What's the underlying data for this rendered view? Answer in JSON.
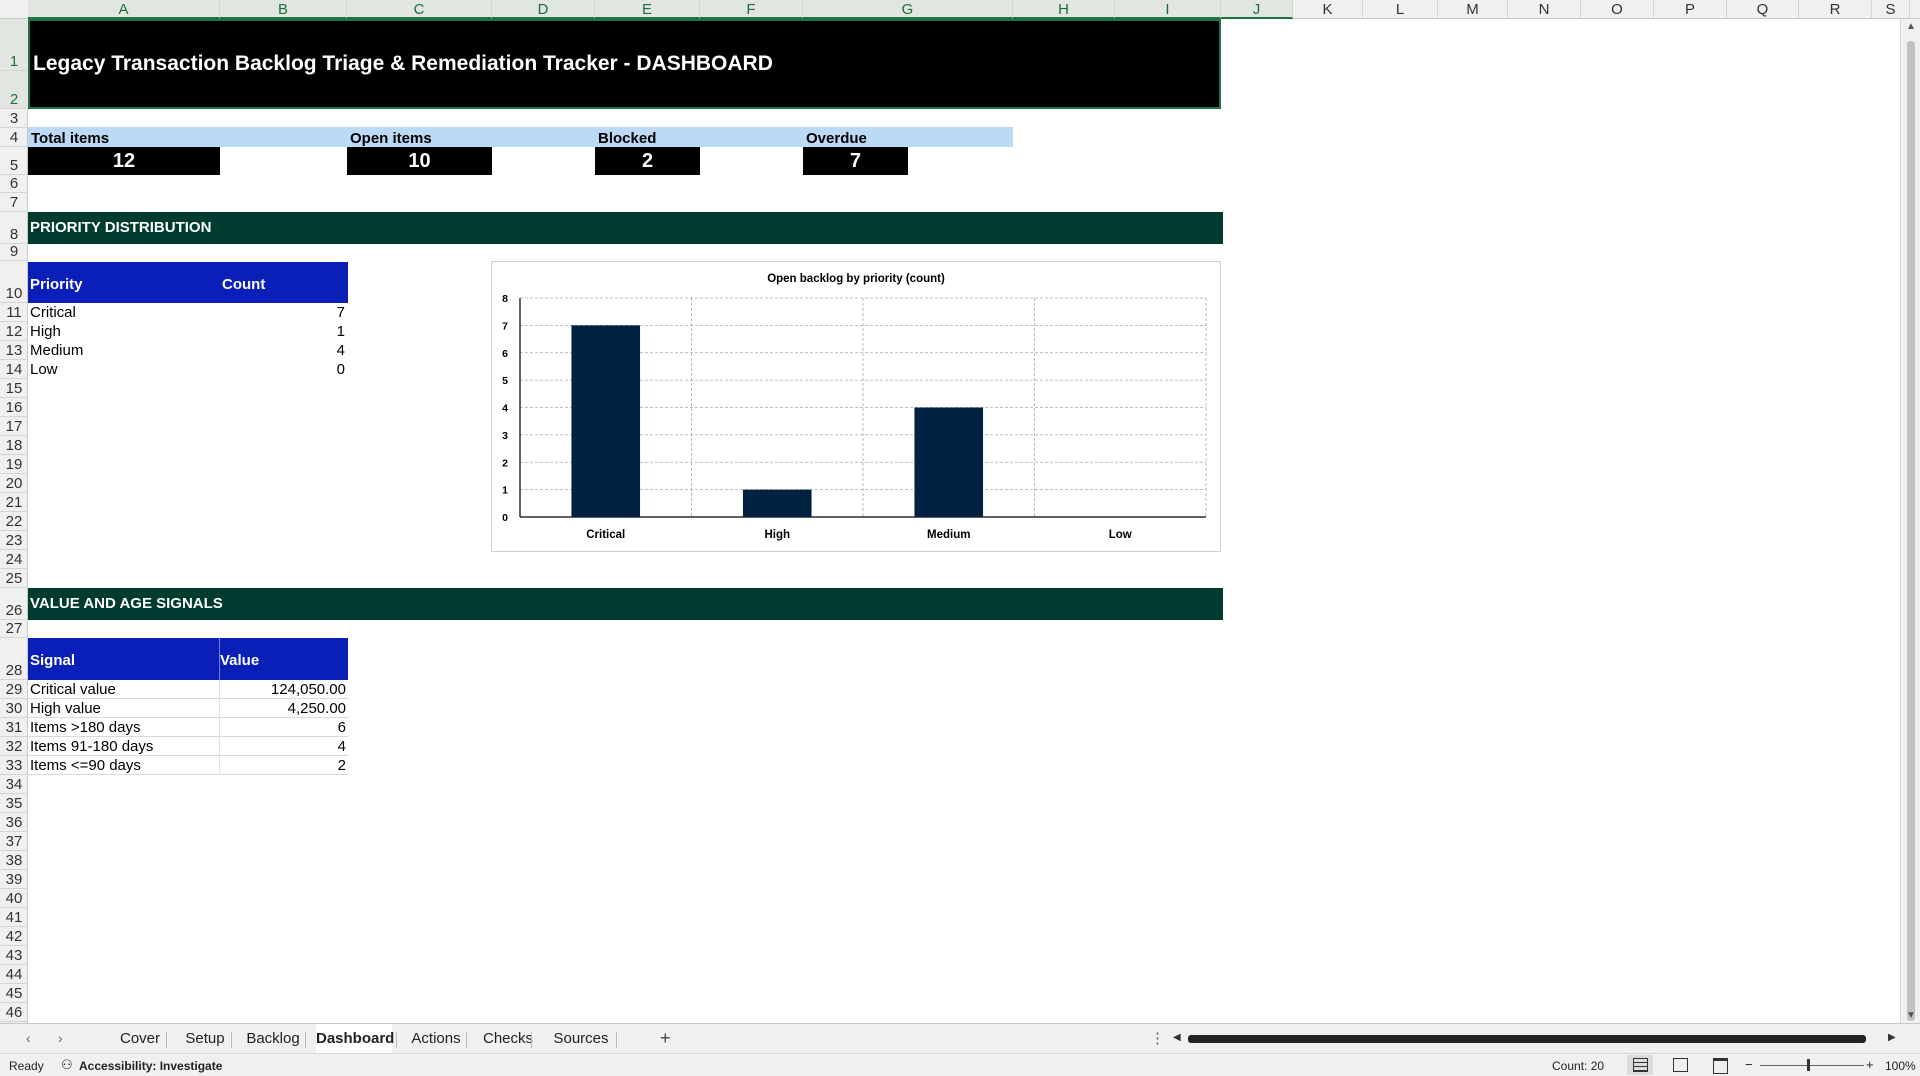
{
  "columns": [
    "A",
    "B",
    "C",
    "D",
    "E",
    "F",
    "G",
    "H",
    "I",
    "J",
    "K",
    "L",
    "M",
    "N",
    "O",
    "P",
    "Q",
    "R",
    "S"
  ],
  "rows": [
    "1",
    "2",
    "3",
    "4",
    "5",
    "6",
    "7",
    "8",
    "9",
    "10",
    "11",
    "12",
    "13",
    "14",
    "15",
    "16",
    "17",
    "18",
    "19",
    "20",
    "21",
    "22",
    "23",
    "24",
    "25",
    "26",
    "27",
    "28",
    "29",
    "30",
    "31",
    "32",
    "33",
    "34",
    "35",
    "36",
    "37",
    "38",
    "39",
    "40",
    "41",
    "42",
    "43",
    "44",
    "45",
    "46"
  ],
  "title": "Legacy Transaction Backlog Triage & Remediation Tracker - DASHBOARD",
  "kpis": {
    "total_label": "Total items",
    "total_value": "12",
    "open_label": "Open items",
    "open_value": "10",
    "blocked_label": "Blocked",
    "blocked_value": "2",
    "overdue_label": "Overdue",
    "overdue_value": "7"
  },
  "sections": {
    "priority": "PRIORITY DISTRIBUTION",
    "value_age": "VALUE AND AGE SIGNALS"
  },
  "priority_table": {
    "header_priority": "Priority",
    "header_count": "Count",
    "rows": [
      {
        "label": "Critical",
        "count": "7"
      },
      {
        "label": "High",
        "count": "1"
      },
      {
        "label": "Medium",
        "count": "4"
      },
      {
        "label": "Low",
        "count": "0"
      }
    ]
  },
  "signal_table": {
    "header_signal": "Signal",
    "header_value": "Value",
    "rows": [
      {
        "label": "Critical value",
        "value": "124,050.00"
      },
      {
        "label": "High value",
        "value": "4,250.00"
      },
      {
        "label": "Items >180 days",
        "value": "6"
      },
      {
        "label": "Items 91-180 days",
        "value": "4"
      },
      {
        "label": "Items <=90 days",
        "value": "2"
      }
    ]
  },
  "chart_data": {
    "type": "bar",
    "title": "Open backlog by priority (count)",
    "categories": [
      "Critical",
      "High",
      "Medium",
      "Low"
    ],
    "values": [
      7,
      1,
      4,
      0
    ],
    "ylim": [
      0,
      8
    ],
    "yticks": [
      "0",
      "1",
      "2",
      "3",
      "4",
      "5",
      "6",
      "7",
      "8"
    ],
    "grid": true,
    "bar_color": "#002240"
  },
  "sheet_tabs": [
    "Cover",
    "Setup",
    "Backlog",
    "Dashboard",
    "Actions",
    "Checks",
    "Sources"
  ],
  "active_tab": "Dashboard",
  "add_sheet": "+",
  "status": {
    "ready": "Ready",
    "accessibility": "Accessibility: Investigate",
    "count": "Count: 20",
    "zoom": "100%"
  }
}
